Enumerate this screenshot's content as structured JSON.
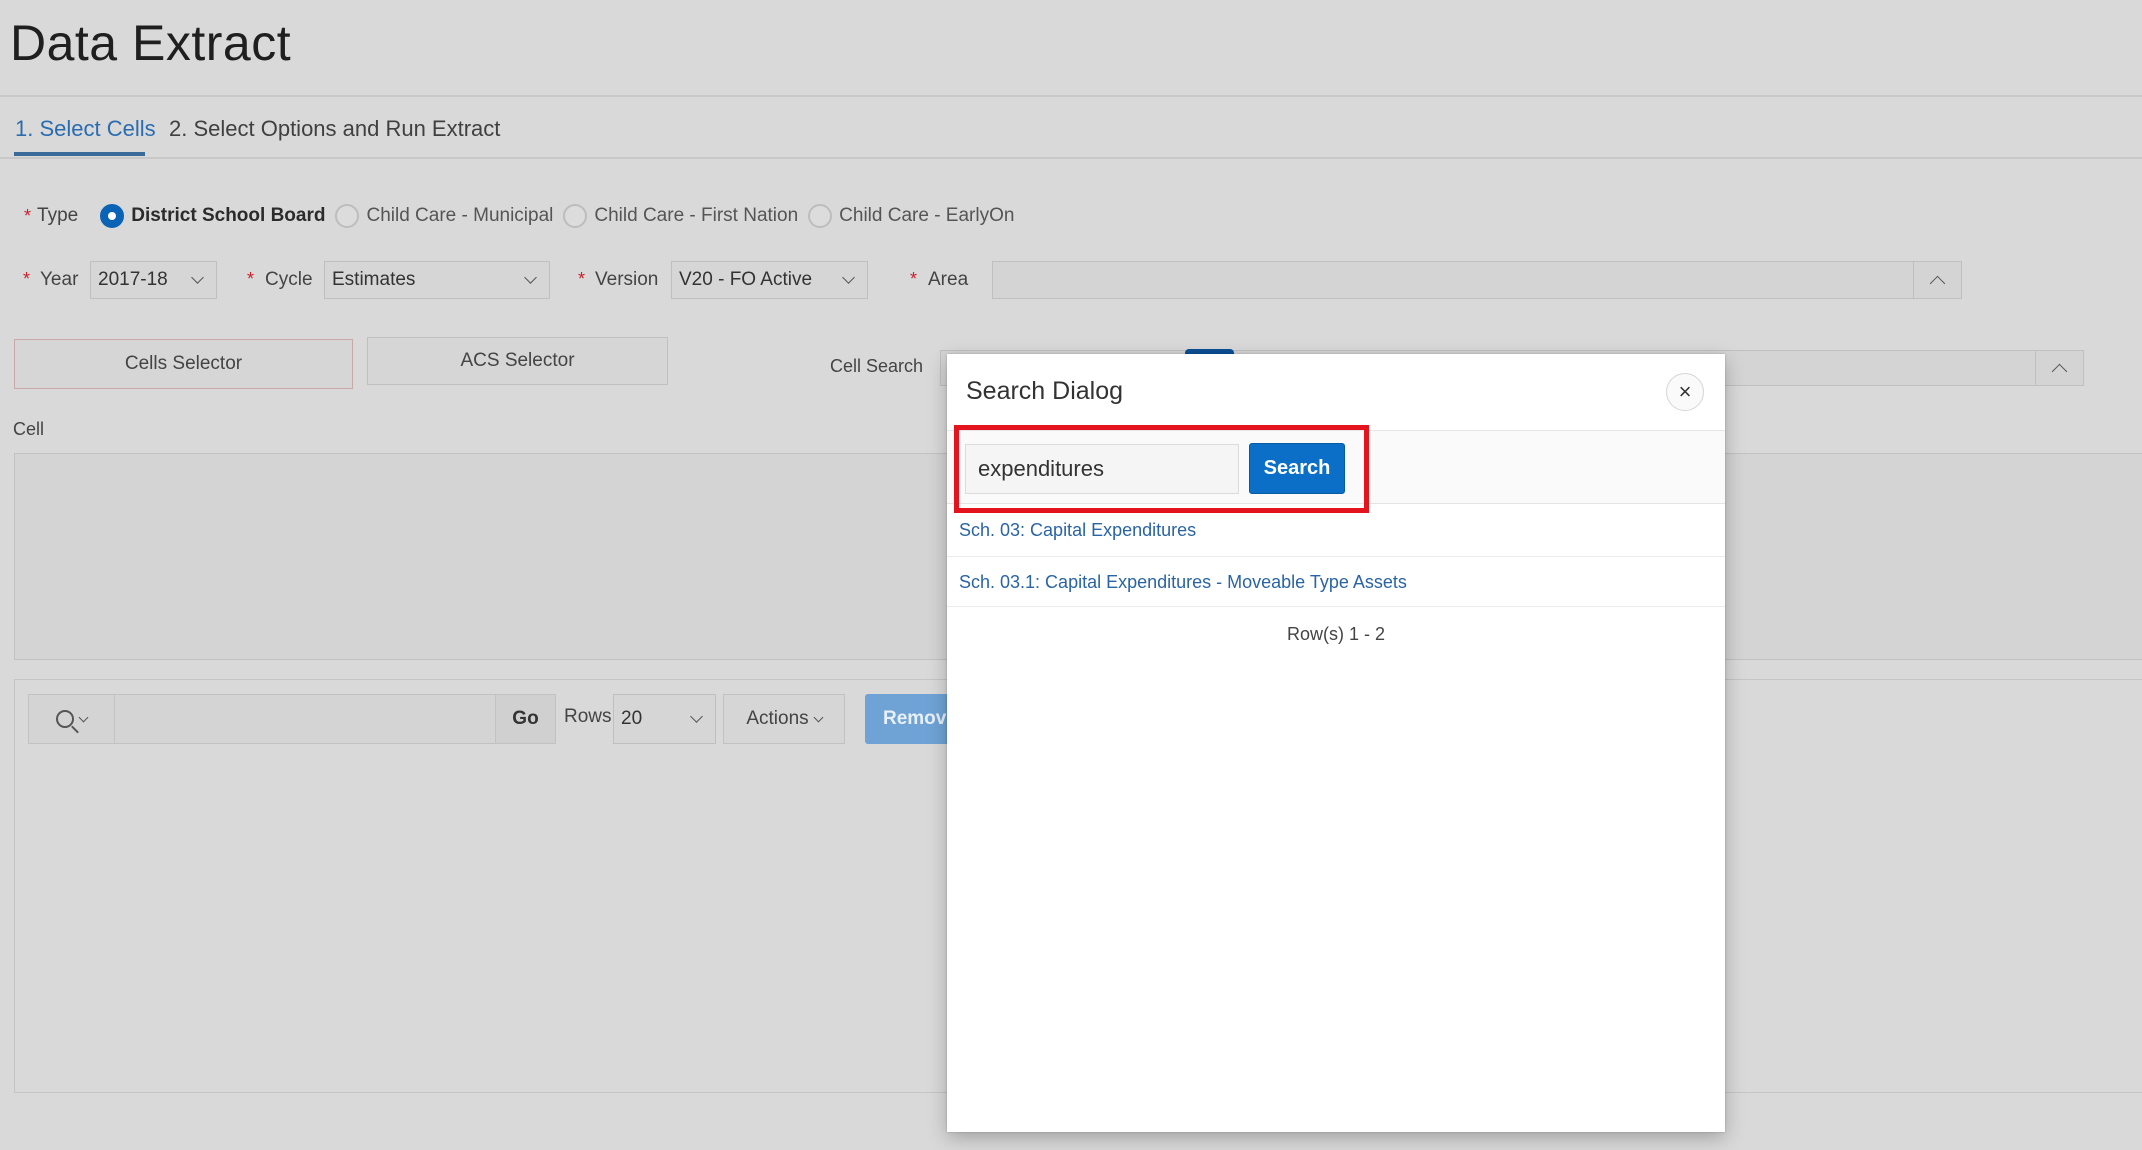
{
  "page": {
    "title": "Data Extract"
  },
  "tabs": [
    {
      "label": "1. Select Cells",
      "active": true
    },
    {
      "label": "2. Select Options and Run Extract",
      "active": false
    }
  ],
  "type_field": {
    "label": "Type",
    "required_marker": "*",
    "options": [
      {
        "label": "District School Board",
        "selected": true
      },
      {
        "label": "Child Care - Municipal",
        "selected": false
      },
      {
        "label": "Child Care - First Nation",
        "selected": false
      },
      {
        "label": "Child Care - EarlyOn",
        "selected": false
      }
    ]
  },
  "filters": {
    "year": {
      "label": "Year",
      "value": "2017-18"
    },
    "cycle": {
      "label": "Cycle",
      "value": "Estimates"
    },
    "version": {
      "label": "Version",
      "value": "V20 - FO Active"
    },
    "area": {
      "label": "Area",
      "value": ""
    },
    "required_marker": "*"
  },
  "selectors": {
    "cells_selector": "Cells Selector",
    "acs_selector": "ACS Selector"
  },
  "cell_search": {
    "label": "Cell Search",
    "value": ""
  },
  "cell": {
    "label": "Cell"
  },
  "report_toolbar": {
    "search_value": "",
    "go_label": "Go",
    "rows_label": "Rows",
    "rows_value": "20",
    "actions_label": "Actions",
    "remove_label": "Remove"
  },
  "search_dialog": {
    "title": "Search Dialog",
    "close_glyph": "×",
    "search_value": "expenditures",
    "search_button": "Search",
    "results": [
      "Sch. 03: Capital Expenditures",
      "Sch. 03.1: Capital Expenditures - Moveable Type Assets"
    ],
    "rows_info": "Row(s) 1 - 2"
  },
  "colors": {
    "accent": "#0b63b5",
    "highlight": "#e3141e",
    "link": "#2a64a2",
    "required": "#cc1f2b"
  }
}
